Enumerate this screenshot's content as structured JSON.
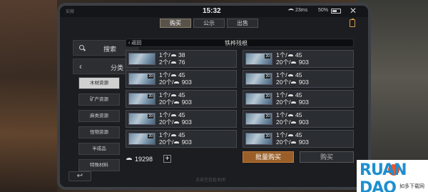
{
  "status_bar": {
    "left_text": "安赫",
    "time": "15:32",
    "network": "23ms",
    "battery": "50%"
  },
  "tabs": [
    {
      "label": "购买",
      "active": true
    },
    {
      "label": "公示",
      "active": false
    },
    {
      "label": "出售",
      "active": false
    }
  ],
  "sidebar": {
    "search_label": "搜索",
    "category_label": "分类",
    "items": [
      {
        "label": "木材资源",
        "active": true
      },
      {
        "label": "矿产资源",
        "active": false
      },
      {
        "label": "麻类资源",
        "active": false
      },
      {
        "label": "怪物资源",
        "active": false
      },
      {
        "label": "半成品",
        "active": false
      },
      {
        "label": "特殊材料",
        "active": false
      }
    ]
  },
  "header": {
    "back_label": "返回",
    "item_title": "铁桦残根"
  },
  "listings": [
    {
      "qty_badge": "",
      "line1": "1个/",
      "line1_price": "38",
      "line2": "2个/",
      "line2_price": "76"
    },
    {
      "qty_badge": "20",
      "line1": "1个/",
      "line1_price": "45",
      "line2": "20个/",
      "line2_price": "903"
    },
    {
      "qty_badge": "20",
      "line1": "1个/",
      "line1_price": "45",
      "line2": "20个/",
      "line2_price": "903"
    },
    {
      "qty_badge": "20",
      "line1": "1个/",
      "line1_price": "45",
      "line2": "20个/",
      "line2_price": "903"
    },
    {
      "qty_badge": "20",
      "line1": "1个/",
      "line1_price": "45",
      "line2": "20个/",
      "line2_price": "903"
    },
    {
      "qty_badge": "20",
      "line1": "1个/",
      "line1_price": "45",
      "line2": "20个/",
      "line2_price": "903"
    },
    {
      "qty_badge": "20",
      "line1": "1个/",
      "line1_price": "45",
      "line2": "20个/",
      "line2_price": "903"
    },
    {
      "qty_badge": "20",
      "line1": "1个/",
      "line1_price": "45",
      "line2": "20个/",
      "line2_price": "903"
    },
    {
      "qty_badge": "20",
      "line1": "1个/",
      "line1_price": "45",
      "line2": "20个/",
      "line2_price": "903"
    },
    {
      "qty_badge": "20",
      "line1": "1个/",
      "line1_price": "45",
      "line2": "20个/",
      "line2_price": "903"
    }
  ],
  "footer": {
    "balance": "19298",
    "add_symbol": "+",
    "bulk_buy_label": "批量购买",
    "buy_label": "购买",
    "hint_text": "点击空白处关闭",
    "back_symbol": "↩"
  },
  "watermark": {
    "brand": "RUAN DAO",
    "sub": "如多下载网"
  },
  "colors": {
    "accent_orange": "#9a5f28",
    "panel_bg": "#1b1d20",
    "card_bg": "#2a2d31"
  }
}
